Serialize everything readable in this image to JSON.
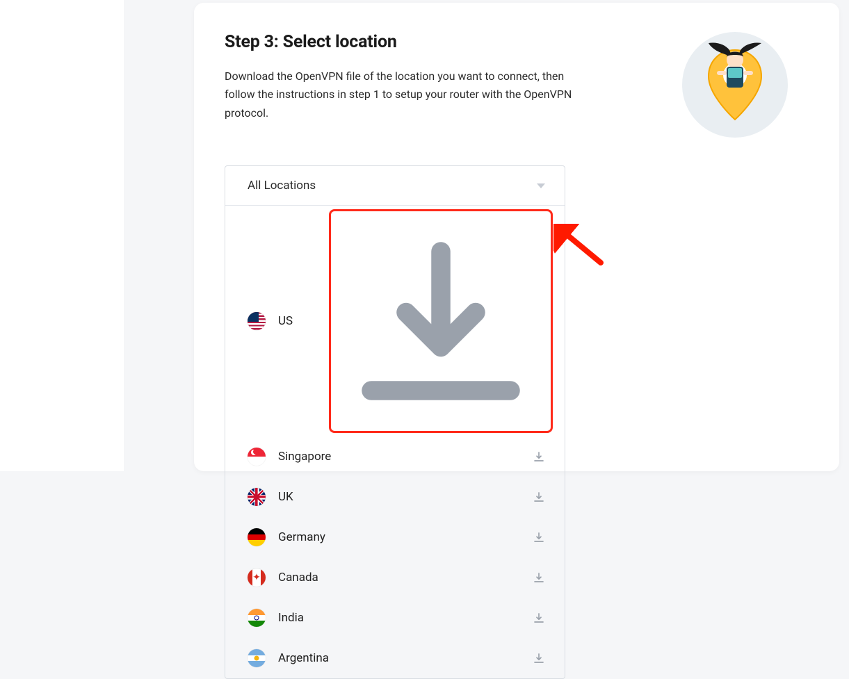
{
  "step": {
    "title": "Step 3: Select location",
    "description": "Download the OpenVPN file of the location you want to connect, then follow the instructions in step 1 to setup your router with the OpenVPN protocol."
  },
  "dropdown_label": "All Locations",
  "locations": [
    {
      "name": "US"
    },
    {
      "name": "Singapore"
    },
    {
      "name": "UK"
    },
    {
      "name": "Germany"
    },
    {
      "name": "Canada"
    },
    {
      "name": "India"
    },
    {
      "name": "Argentina"
    }
  ]
}
